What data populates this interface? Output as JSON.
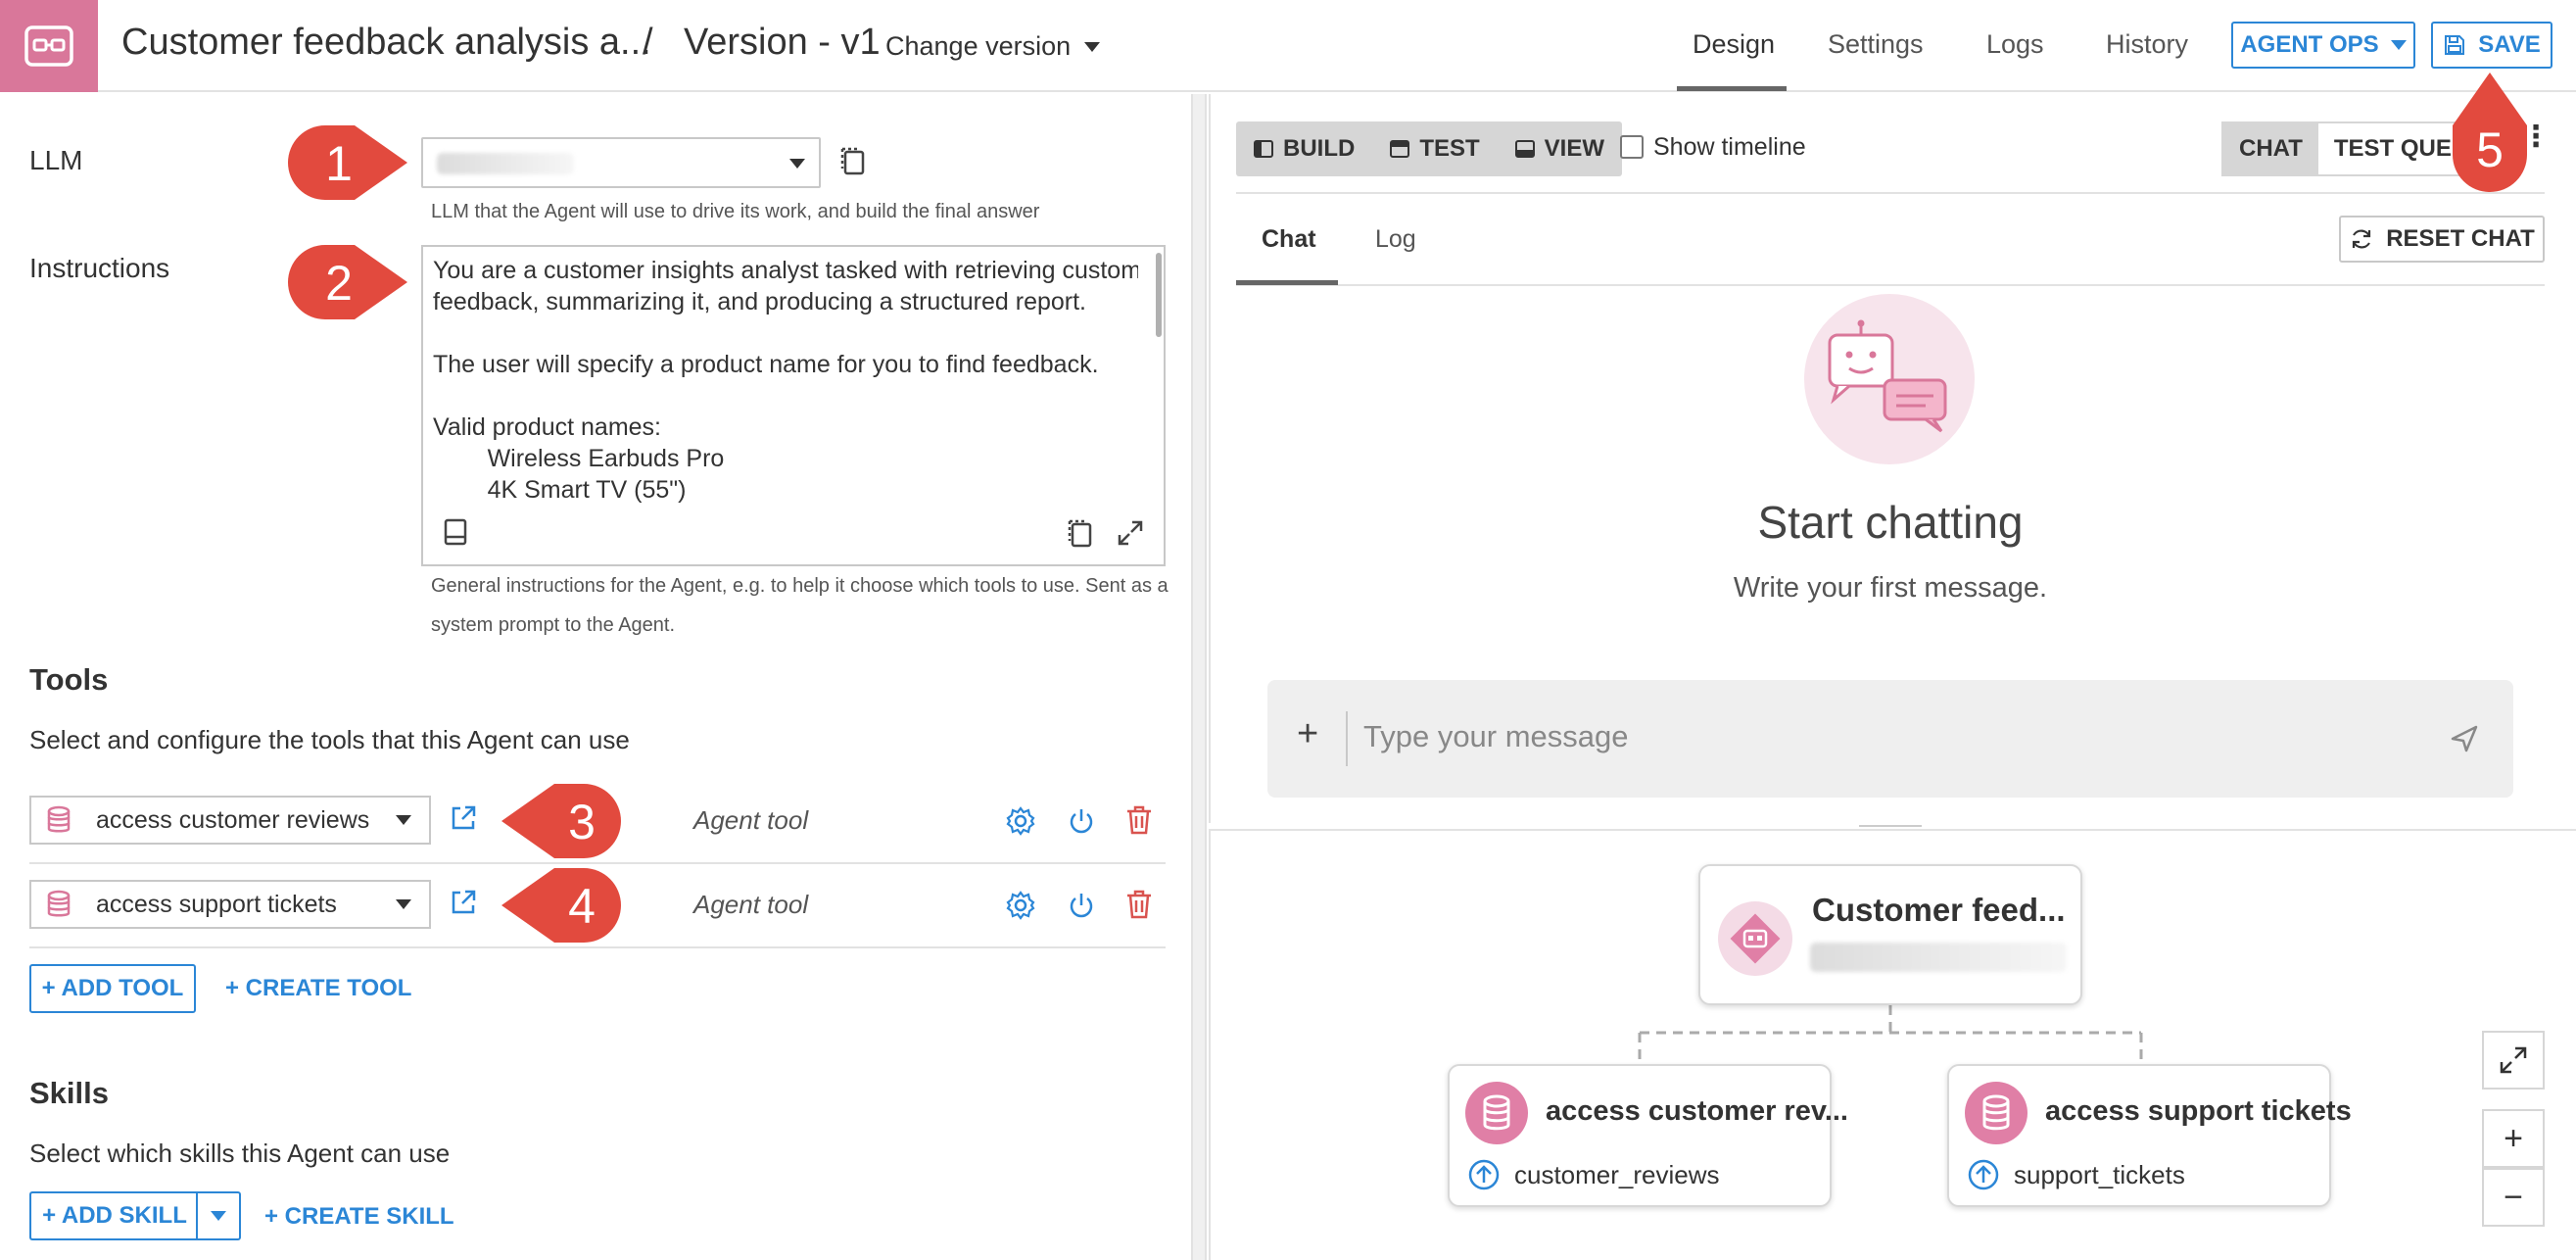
{
  "header": {
    "app_title": "Customer feedback analysis a...",
    "breadcrumb_separator": "/",
    "version_title": "Version - v1",
    "change_version_label": "Change version",
    "tabs": [
      {
        "label": "Design",
        "active": true
      },
      {
        "label": "Settings",
        "active": false
      },
      {
        "label": "Logs",
        "active": false
      },
      {
        "label": "History",
        "active": false
      }
    ],
    "agent_ops_label": "AGENT OPS",
    "save_label": "SAVE"
  },
  "left": {
    "llm_label": "LLM",
    "llm_help": "LLM that the Agent will use to drive its work, and build the final answer",
    "instructions_label": "Instructions",
    "instructions_text": "You are a customer insights analyst tasked with retrieving customer\nfeedback, summarizing it, and producing a structured report.\n\nThe user will specify a product name for you to find feedback.\n\nValid product names:\n        Wireless Earbuds Pro\n        4K Smart TV (55\")",
    "instructions_help_line1": "General instructions for the Agent, e.g. to help it choose which tools to use. Sent as a",
    "instructions_help_line2": "system prompt to the Agent.",
    "tools_title": "Tools",
    "tools_sub": "Select and configure the tools that this Agent can use",
    "tools": [
      {
        "name": "access customer reviews",
        "type": "Agent tool"
      },
      {
        "name": "access support tickets",
        "type": "Agent tool"
      }
    ],
    "add_tool_label": "+ ADD TOOL",
    "create_tool_label": "+ CREATE TOOL",
    "skills_title": "Skills",
    "skills_sub": "Select which skills this Agent can use",
    "add_skill_label": "+ ADD SKILL",
    "create_skill_label": "+ CREATE SKILL"
  },
  "callouts": [
    "1",
    "2",
    "3",
    "4",
    "5"
  ],
  "chat": {
    "modes": [
      "BUILD",
      "TEST",
      "VIEW"
    ],
    "show_timeline_label": "Show timeline",
    "chat_tab_label": "CHAT",
    "test_query_label": "TEST QUERY",
    "subtabs": [
      "Chat",
      "Log"
    ],
    "reset_label": "RESET CHAT",
    "empty_title": "Start chatting",
    "empty_sub": "Write your first message.",
    "input_plus": "+",
    "input_placeholder": "Type your message"
  },
  "graph": {
    "root_title": "Customer feed...",
    "children": [
      {
        "title": "access customer rev...",
        "sub": "customer_reviews"
      },
      {
        "title": "access support tickets",
        "sub": "support_tickets"
      }
    ],
    "zoom_in": "+",
    "zoom_out": "−"
  },
  "colors": {
    "accent": "#2b86d6",
    "brand_pink": "#d9779a",
    "callout_red": "#e24a3e",
    "delete_red": "#d9534f"
  }
}
